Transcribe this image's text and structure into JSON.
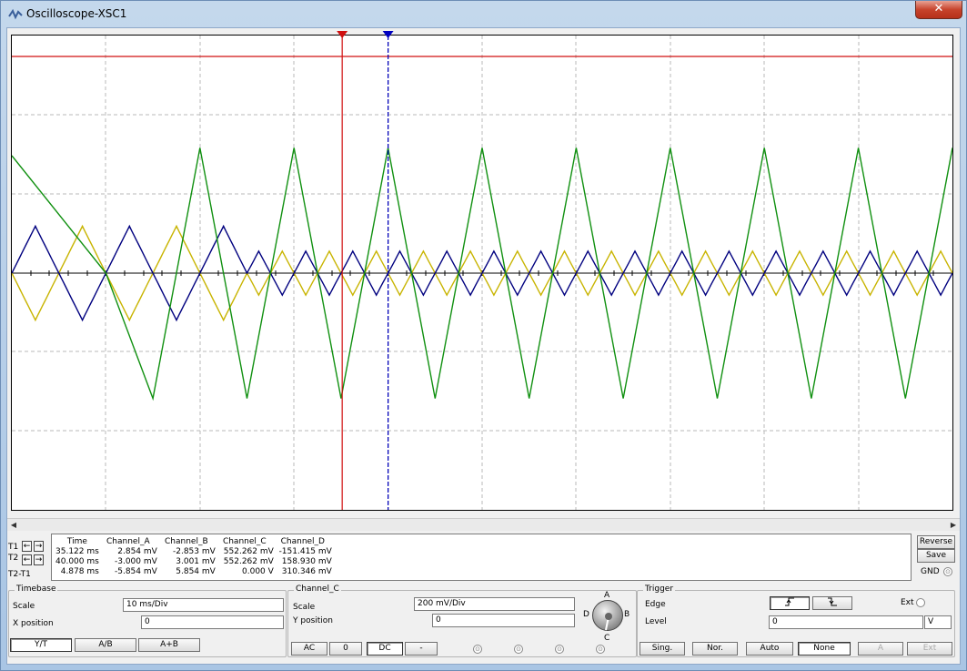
{
  "window": {
    "title": "Oscilloscope-XSC1",
    "close_label": "✕"
  },
  "readout": {
    "headers": [
      "Time",
      "Channel_A",
      "Channel_B",
      "Channel_C",
      "Channel_D"
    ],
    "row_labels": [
      "T1",
      "T2",
      "T2-T1"
    ],
    "rows": [
      [
        "35.122 ms",
        "2.854 mV",
        "-2.853 mV",
        "552.262 mV",
        "-151.415 mV"
      ],
      [
        "40.000 ms",
        "-3.000 mV",
        "3.001 mV",
        "552.262 mV",
        "158.930 mV"
      ],
      [
        "4.878 ms",
        "-5.854 mV",
        "5.854 mV",
        "0.000 V",
        "310.346 mV"
      ]
    ]
  },
  "side": {
    "reverse_label": "Reverse",
    "save_label": "Save",
    "gnd_label": "GND"
  },
  "timebase": {
    "title": "Timebase",
    "scale_label": "Scale",
    "scale_value": "10 ms/Div",
    "xpos_label": "X position",
    "xpos_value": "0",
    "buttons": [
      "Y/T",
      "A/B",
      "A+B"
    ]
  },
  "channel": {
    "title": "Channel_C",
    "scale_label": "Scale",
    "scale_value": "200 mV/Div",
    "ypos_label": "Y position",
    "ypos_value": "0",
    "buttons": [
      "AC",
      "0",
      "DC",
      "-"
    ],
    "knob_labels": {
      "a": "A",
      "b": "B",
      "c": "C",
      "d": "D"
    }
  },
  "trigger": {
    "title": "Trigger",
    "edge_label": "Edge",
    "ext_label": "Ext",
    "level_label": "Level",
    "level_value": "0",
    "level_unit": "V",
    "buttons": [
      "Sing.",
      "Nor.",
      "Auto",
      "None",
      "A",
      "Ext"
    ]
  },
  "colors": {
    "channel_a": "#c8b400",
    "channel_b": "#00007f",
    "channel_c": "#109010",
    "channel_d": "#d01010",
    "cursor1": "#d01010",
    "cursor2": "#0000c0"
  },
  "chart_data": {
    "type": "line",
    "x_unit": "ms",
    "xlim": [
      0,
      100
    ],
    "cursors": {
      "t1": 35.122,
      "t2": 40.0
    },
    "series": [
      {
        "name": "Channel_C",
        "x": [
          0,
          10,
          15,
          20,
          25,
          30,
          35,
          40,
          45,
          50,
          55,
          60,
          65,
          70,
          75,
          80,
          85,
          90,
          95,
          100
        ],
        "y": [
          1.5,
          0,
          -1.6,
          1.6,
          -1.6,
          1.6,
          -1.6,
          1.6,
          -1.6,
          1.6,
          -1.6,
          1.6,
          -1.6,
          1.6,
          -1.6,
          1.6,
          -1.6,
          1.6,
          -1.6,
          1.6
        ]
      }
    ]
  }
}
